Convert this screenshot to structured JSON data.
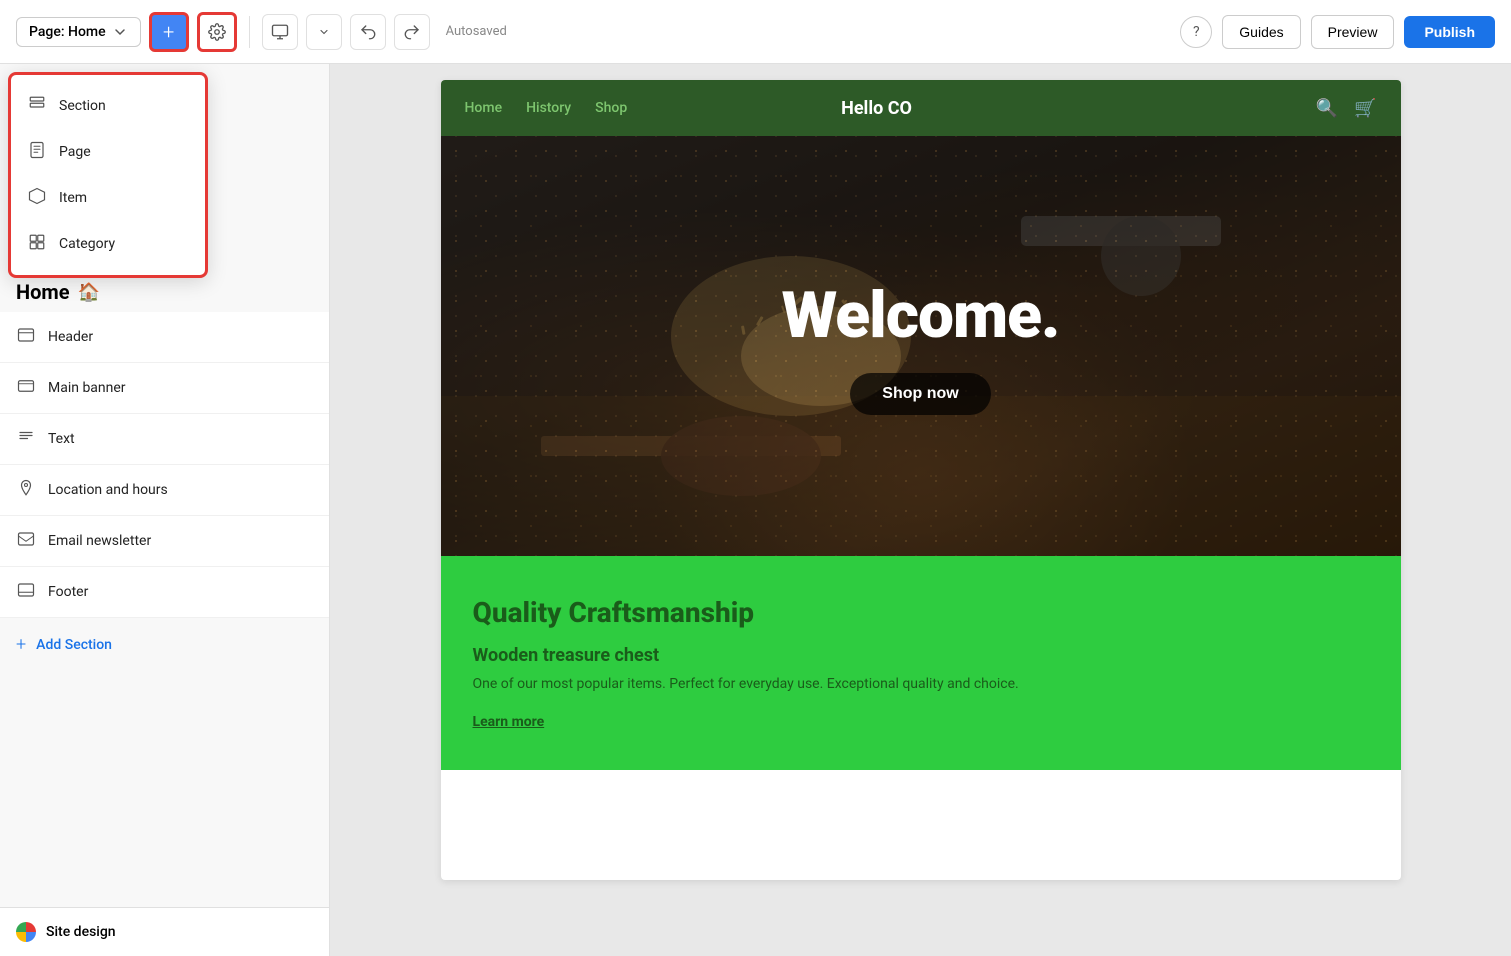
{
  "topbar": {
    "page_selector_label": "Page: Home",
    "autosaved_text": "Autosaved",
    "guides_label": "Guides",
    "preview_label": "Preview",
    "publish_label": "Publish"
  },
  "dropdown": {
    "items": [
      {
        "id": "section",
        "label": "Section",
        "icon": "section"
      },
      {
        "id": "page",
        "label": "Page",
        "icon": "page"
      },
      {
        "id": "item",
        "label": "Item",
        "icon": "item"
      },
      {
        "id": "category",
        "label": "Category",
        "icon": "category"
      }
    ]
  },
  "sidebar": {
    "title": "Home",
    "items": [
      {
        "id": "header",
        "label": "Header",
        "icon": "header"
      },
      {
        "id": "main-banner",
        "label": "Main banner",
        "icon": "main-banner"
      },
      {
        "id": "text",
        "label": "Text",
        "icon": "text"
      },
      {
        "id": "location-hours",
        "label": "Location and hours",
        "icon": "location"
      },
      {
        "id": "email-newsletter",
        "label": "Email newsletter",
        "icon": "email"
      },
      {
        "id": "footer",
        "label": "Footer",
        "icon": "footer"
      }
    ],
    "add_section_label": "Add Section",
    "site_design_label": "Site design"
  },
  "preview": {
    "nav": {
      "links": [
        "Home",
        "History",
        "Shop"
      ],
      "brand": "Hello CO",
      "active_link": "Home"
    },
    "hero": {
      "title": "Welcome.",
      "cta_label": "Shop now"
    },
    "green_section": {
      "title": "Quality Craftsmanship",
      "product_name": "Wooden treasure chest",
      "description": "One of our most popular items. Perfect for everyday use. Exceptional quality and choice.",
      "link_label": "Learn more"
    }
  },
  "colors": {
    "publish_bg": "#1a73e8",
    "add_btn_bg": "#4285f4",
    "highlight_border": "#e53935",
    "nav_bg": "#2d5a27",
    "nav_link": "#7dc56e",
    "hero_bg": "#1a1a1a",
    "green_section_bg": "#2ecc40",
    "green_text": "#1a5c1a"
  }
}
